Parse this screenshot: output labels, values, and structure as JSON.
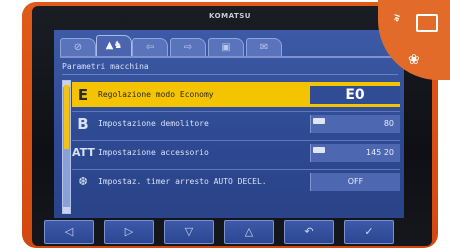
{
  "device": {
    "brand": "KOMATSU"
  },
  "corner": {
    "text": "al"
  },
  "tabs": [
    {
      "name": "tab-1",
      "icon": "⊘",
      "active": false
    },
    {
      "name": "tab-2",
      "icon": "▲♞",
      "active": true
    },
    {
      "name": "tab-3",
      "icon": "⇦",
      "active": false
    },
    {
      "name": "tab-4",
      "icon": "⇨",
      "active": false
    },
    {
      "name": "tab-5",
      "icon": "▣",
      "active": false
    },
    {
      "name": "tab-6",
      "icon": "✉",
      "active": false
    }
  ],
  "header": {
    "title": "Parametri macchina"
  },
  "rows": [
    {
      "badge": "E",
      "label": "Regolazione modo Economy",
      "value": "E0",
      "selected": true
    },
    {
      "badge": "B",
      "label": "Impostazione demolitore",
      "value": "80",
      "selected": false
    },
    {
      "badge": "ATT",
      "label": "Impostazione accessorio",
      "value": "145   20",
      "selected": false
    },
    {
      "badge": "❆",
      "label": "Impostaz. timer arresto AUTO DECEL.",
      "value": "OFF",
      "selected": false
    }
  ],
  "fkeys": [
    {
      "name": "fkey-left-button",
      "glyph": "◁"
    },
    {
      "name": "fkey-right-button",
      "glyph": "▷"
    },
    {
      "name": "fkey-down-button",
      "glyph": "▽"
    },
    {
      "name": "fkey-up-button",
      "glyph": "△"
    },
    {
      "name": "fkey-back-button",
      "glyph": "↶"
    },
    {
      "name": "fkey-confirm-button",
      "glyph": "✓"
    }
  ]
}
